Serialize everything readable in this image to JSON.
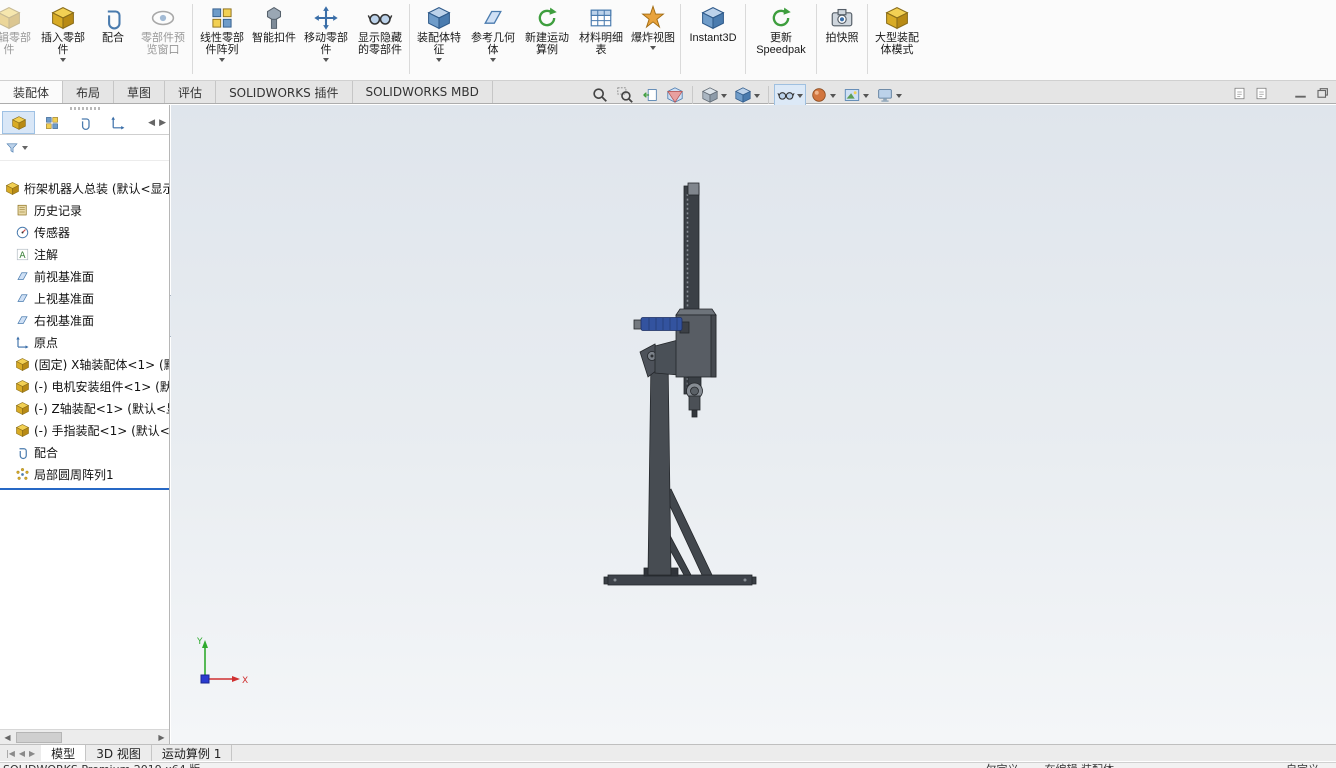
{
  "colors": {
    "accent": "#2668c5",
    "viewport_top": "#dfe5ec",
    "viewport_bottom": "#f4f6f8",
    "model_gray": "#474c52",
    "motor_blue": "#33539f",
    "triad_x_red": "#d03030",
    "triad_y_green": "#2faa2f",
    "triad_z_blue": "#2a3bd0"
  },
  "ribbon": {
    "items": [
      {
        "label": "编辑零部件",
        "icon": "edit-component-icon",
        "disabled": true
      },
      {
        "label": "插入零部件",
        "icon": "insert-component-icon",
        "dropdown": true
      },
      {
        "label": "配合",
        "icon": "mate-icon"
      },
      {
        "label": "零部件预览窗口",
        "icon": "component-preview-window-icon",
        "disabled": true
      },
      {
        "label": "线性零部件阵列",
        "icon": "linear-component-pattern-icon",
        "dropdown": true
      },
      {
        "label": "智能扣件",
        "icon": "smart-fasteners-icon"
      },
      {
        "label": "移动零部件",
        "icon": "move-component-icon",
        "dropdown": true
      },
      {
        "label": "显示隐藏的零部件",
        "icon": "show-hidden-components-icon"
      },
      {
        "label": "装配体特征",
        "icon": "assembly-features-icon",
        "dropdown": true
      },
      {
        "label": "参考几何体",
        "icon": "reference-geometry-icon",
        "dropdown": true
      },
      {
        "label": "新建运动算例",
        "icon": "new-motion-study-icon"
      },
      {
        "label": "材料明细表",
        "icon": "bill-of-materials-icon"
      },
      {
        "label": "爆炸视图",
        "icon": "exploded-view-icon",
        "dropdown": true
      },
      {
        "label": "Instant3D",
        "icon": "instant3d-icon"
      },
      {
        "label": "更新 Speedpak",
        "icon": "update-speedpak-icon"
      },
      {
        "label": "拍快照",
        "icon": "take-snapshot-icon"
      },
      {
        "label": "大型装配体模式",
        "icon": "large-assembly-mode-icon"
      }
    ]
  },
  "cmd_tabs": {
    "active_index": 0,
    "items": [
      "装配体",
      "布局",
      "草图",
      "评估",
      "SOLIDWORKS 插件",
      "SOLIDWORKS MBD"
    ]
  },
  "headsup": {
    "buttons": [
      {
        "icon": "zoom-to-fit-icon"
      },
      {
        "icon": "zoom-to-area-icon"
      },
      {
        "icon": "previous-view-icon"
      },
      {
        "icon": "section-view-icon"
      },
      {
        "icon": "view-orientation-icon",
        "dropdown": true
      },
      {
        "icon": "display-style-icon",
        "dropdown": true
      },
      {
        "icon": "hide-show-items-icon",
        "dropdown": true,
        "pressed": true
      },
      {
        "icon": "edit-appearance-icon",
        "dropdown": true
      },
      {
        "icon": "apply-scene-icon",
        "dropdown": true
      },
      {
        "icon": "view-settings-icon",
        "dropdown": true
      }
    ]
  },
  "window_buttons": {
    "icons": [
      "previous-pane-icon",
      "next-pane-icon",
      "minimize-icon",
      "restore-icon"
    ]
  },
  "panel": {
    "tabs": {
      "active_index": 0,
      "icons": [
        "featuremanager-tab-icon",
        "propertymanager-tab-icon",
        "configurationmanager-tab-icon",
        "dimxpert-tab-icon"
      ]
    },
    "filter_icon": "filter-funnel-icon",
    "tree": [
      {
        "label": "桁架机器人总装 (默认<显示",
        "icon": "assembly-root-icon"
      },
      {
        "label": "历史记录",
        "icon": "history-folder-icon"
      },
      {
        "label": "传感器",
        "icon": "sensors-icon"
      },
      {
        "label": "注解",
        "icon": "annotations-icon"
      },
      {
        "label": "前视基准面",
        "icon": "plane-icon"
      },
      {
        "label": "上视基准面",
        "icon": "plane-icon"
      },
      {
        "label": "右视基准面",
        "icon": "plane-icon"
      },
      {
        "label": "原点",
        "icon": "origin-icon"
      },
      {
        "label": "(固定) X轴装配体<1> (默",
        "icon": "component-icon"
      },
      {
        "label": "(-) 电机安装组件<1> (默",
        "icon": "component-icon"
      },
      {
        "label": "(-) Z轴装配<1> (默认<显",
        "icon": "component-icon"
      },
      {
        "label": "(-) 手指装配<1> (默认<",
        "icon": "component-icon"
      },
      {
        "label": "配合",
        "icon": "mates-icon"
      },
      {
        "label": "局部圆周阵列1",
        "icon": "circular-pattern-icon"
      }
    ]
  },
  "viewport": {
    "triad": {
      "x": "X",
      "y": "Y"
    }
  },
  "doc_tabs": {
    "active_index": 0,
    "items": [
      "模型",
      "3D 视图",
      "运动算例 1"
    ]
  },
  "status": {
    "product": "SOLIDWORKS Premium 2019 x64 版",
    "define_state": "欠定义",
    "edit_state": "在编辑 装配体",
    "customize": "自定义"
  }
}
